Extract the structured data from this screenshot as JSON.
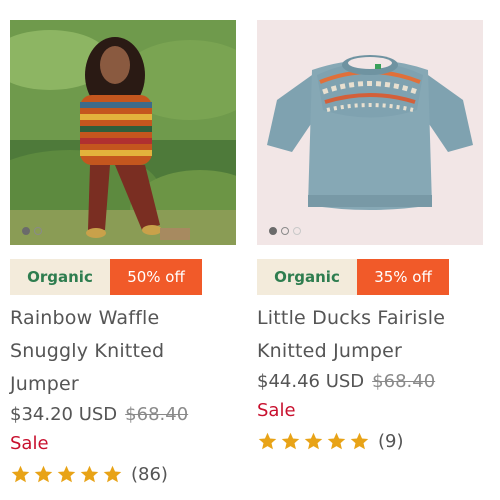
{
  "products": [
    {
      "badge_tag": "Organic",
      "badge_discount": "50% off",
      "title_line1": "Rainbow Waffle",
      "title_line2": "Snuggly Knitted Jumper",
      "price": "$34.20 USD",
      "compare_price": "$68.40",
      "sale_label": "Sale",
      "rating_stars": 5,
      "review_count": "(86)",
      "image_icon": "child-in-striped-jumper-photo"
    },
    {
      "badge_tag": "Organic",
      "badge_discount": "35% off",
      "title_line1": "Little Ducks Fairisle",
      "title_line2": "Knitted Jumper",
      "price": "$44.46 USD",
      "compare_price": "$68.40",
      "sale_label": "Sale",
      "rating_stars": 5,
      "review_count": "(9)",
      "image_icon": "blue-fairisle-jumper-photo"
    }
  ],
  "colors": {
    "organic_badge_bg": "#f3ebdb",
    "organic_badge_text": "#2e7d4f",
    "discount_badge_bg": "#f15a29",
    "sale_text": "#c8102e",
    "star": "#e8a317"
  }
}
